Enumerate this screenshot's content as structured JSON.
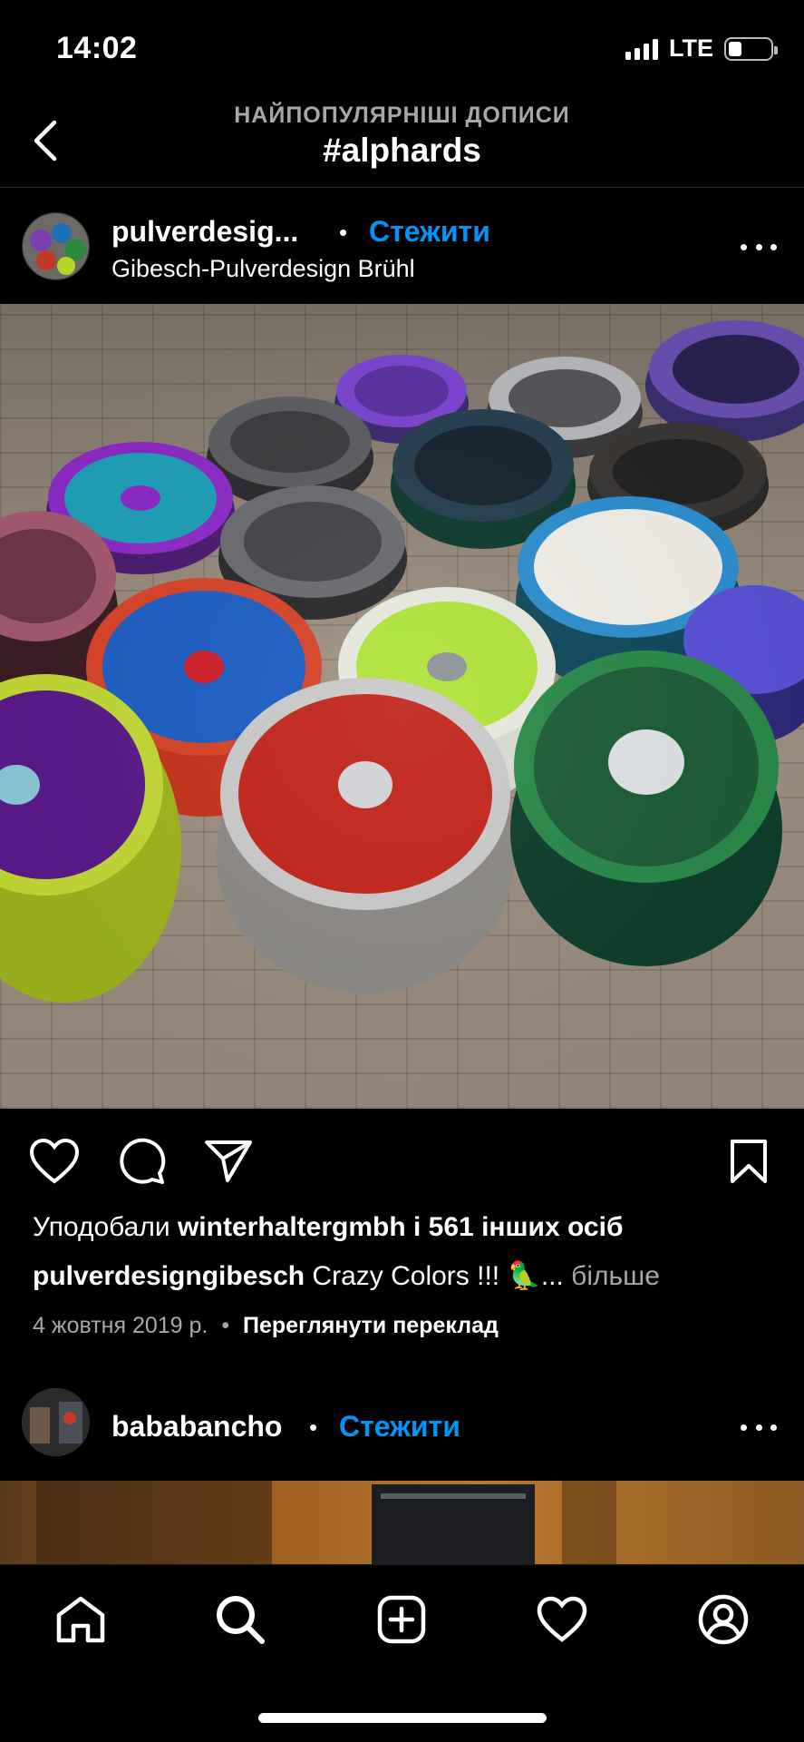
{
  "status_bar": {
    "time": "14:02",
    "network": "LTE",
    "signal_bars": 4,
    "battery_level": 0.25
  },
  "header": {
    "subtitle": "НАЙПОПУЛЯРНІШІ ДОПИСИ",
    "title": "#alphards"
  },
  "post": {
    "username": "pulverdesig...",
    "separator": "•",
    "follow_label": "Стежити",
    "location": "Gibesch-Pulverdesign Brühl",
    "likes_prefix": "Уподобали",
    "likes_user": "winterhaltergmbh",
    "likes_suffix": "і 561 інших осіб",
    "caption_user": "pulverdesigngibesch",
    "caption_text": "Crazy Colors !!! 🦜...",
    "caption_more": "більше",
    "date": "4 жовтня 2019 р.",
    "meta_separator": "•",
    "translate_label": "Переглянути переклад"
  },
  "next_post": {
    "username": "bababancho",
    "separator": "•",
    "follow_label": "Стежити"
  },
  "tab_bar": {
    "items": [
      "home-icon",
      "search-icon",
      "create-icon",
      "activity-icon",
      "profile-icon"
    ]
  },
  "colors": {
    "accent": "#0095f6",
    "background": "#000000",
    "muted": "#a8a8a8"
  }
}
